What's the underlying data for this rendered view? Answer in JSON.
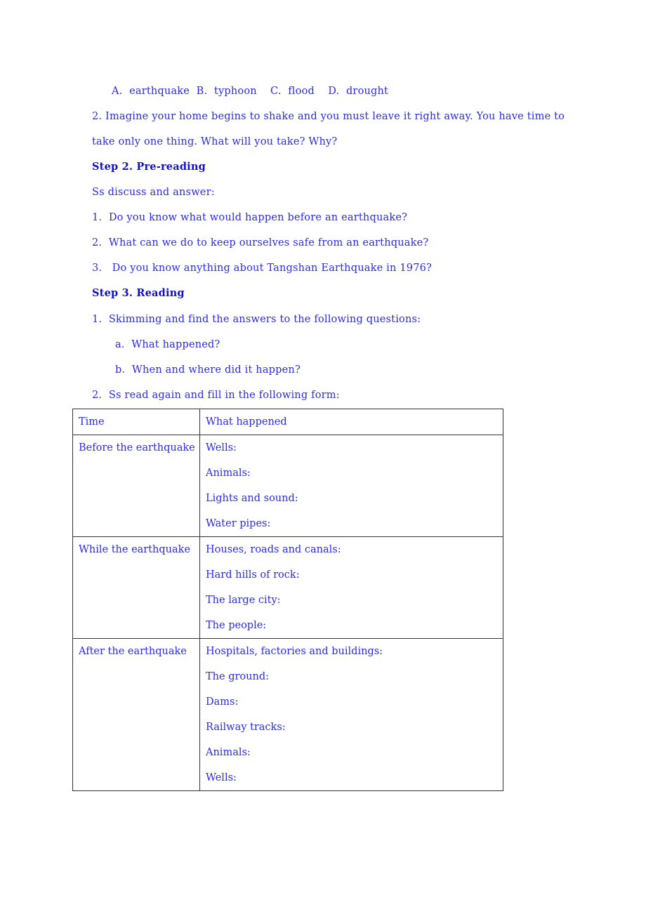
{
  "section1": {
    "options_line": "A.  earthquake  B.  typhoon    C.  flood    D.  drought",
    "question2_line1": "2. Imagine your home begins to shake and you must leave it right away. You have time to",
    "question2_line2": "take only one thing. What will you take? Why?"
  },
  "step2": {
    "heading": "Step 2. Pre-reading",
    "intro": "Ss discuss and answer:",
    "questions": [
      "1.  Do you know what would happen before an earthquake?",
      "2.  What can we do to keep ourselves safe from an earthquake?",
      "3.   Do you know anything about Tangshan Earthquake in 1976?"
    ]
  },
  "step3": {
    "heading": "Step 3. Reading",
    "task1": "1.  Skimming and find the answers to the following questions:",
    "subquestions": [
      "a.  What happened?",
      "b.  When and where did it happen?"
    ],
    "task2": "2.  Ss read again and fill in the following form:"
  },
  "table": {
    "headers": [
      "Time",
      "What happened"
    ],
    "rows": [
      {
        "time": "Before the earthquake",
        "items": [
          "Wells:",
          "Animals:",
          "Lights and sound:",
          "Water pipes:"
        ]
      },
      {
        "time": "While the earthquake",
        "items": [
          "Houses, roads and canals:",
          "Hard hills of rock:",
          "The large city:",
          "The people:"
        ]
      },
      {
        "time": "After the earthquake",
        "items": [
          "Hospitals, factories and buildings:",
          "The ground:",
          "Dams:",
          "Railway tracks:",
          "Animals:",
          "Wells:"
        ]
      }
    ]
  }
}
